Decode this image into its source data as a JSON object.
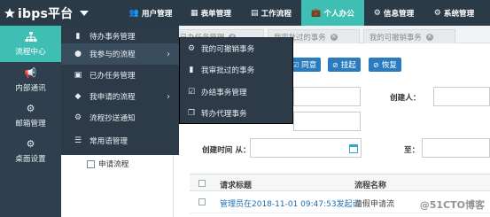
{
  "header": {
    "brand": "ibps平台",
    "nav": [
      {
        "label": "用户管理",
        "icon": "users-icon"
      },
      {
        "label": "表单管理",
        "icon": "form-icon"
      },
      {
        "label": "工作流程",
        "icon": "workflow-icon"
      },
      {
        "label": "个人办公",
        "icon": "briefcase-icon"
      },
      {
        "label": "信息管理",
        "icon": "gear-icon"
      },
      {
        "label": "系统管理",
        "icon": "gear-icon"
      }
    ]
  },
  "sidebar": {
    "items": [
      {
        "label": "流程中心",
        "icon": "sitemap-icon"
      },
      {
        "label": "内部通讯",
        "icon": "megaphone-icon"
      },
      {
        "label": "邮箱管理",
        "icon": "gear-icon"
      },
      {
        "label": "桌面设置",
        "icon": "gear-icon"
      }
    ]
  },
  "menu": {
    "items": [
      {
        "label": "待办事务管理",
        "icon": "bookmark-icon"
      },
      {
        "label": "我参与的流程",
        "icon": "circle-icon"
      },
      {
        "label": "已办任务管理",
        "icon": "inbox-icon"
      },
      {
        "label": "我申请的流程",
        "icon": "diamond-icon"
      },
      {
        "label": "流程抄送通知",
        "icon": "gear-icon"
      },
      {
        "label": "常用语管理",
        "icon": "list-icon"
      }
    ]
  },
  "submenu": {
    "items": [
      {
        "label": "我的可撤销事务",
        "icon": "gear-icon"
      },
      {
        "label": "我审批过的事务",
        "icon": "file-icon"
      },
      {
        "label": "办结事务管理",
        "icon": "check-icon"
      },
      {
        "label": "转办代理事务",
        "icon": "copy-icon"
      }
    ]
  },
  "tabs": [
    {
      "label": "已办任务管理"
    },
    {
      "label": "我审批过的事务"
    },
    {
      "label": "我的可撤销事务"
    }
  ],
  "toolbar": {
    "agree": "同意",
    "suspend": "挂起",
    "restore": "恢复"
  },
  "form": {
    "creator_label": "创建人：",
    "created_time_label": "创建时间 从：",
    "to_label": "至："
  },
  "tree": {
    "item": "申请流程"
  },
  "grid": {
    "columns": [
      "请求标题",
      "流程名称"
    ],
    "rows": [
      {
        "title": "管理员在2018-11-01 09:47:53发起请",
        "flow": "请假申请流"
      }
    ]
  },
  "watermark": "@51CTO博客",
  "colors": {
    "topbar": "#2b3a47",
    "accent": "#3fbfb4",
    "menu": "#2d3b48",
    "button": "#2b7bbf"
  }
}
